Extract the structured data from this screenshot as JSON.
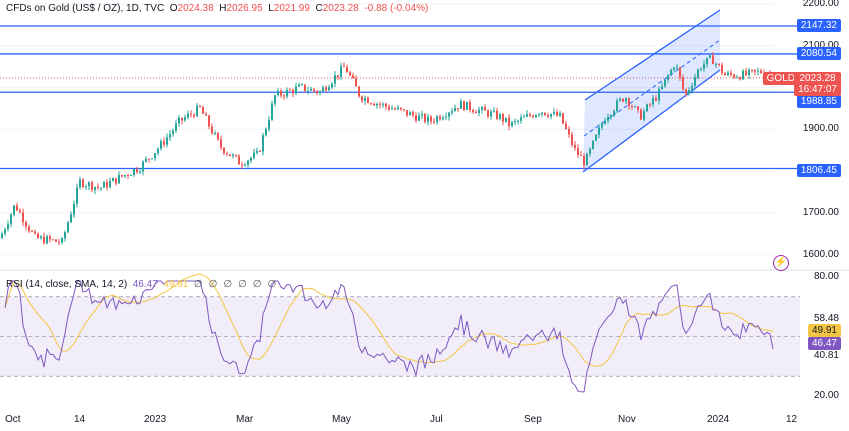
{
  "header": {
    "symbol": "CFDs on Gold (US$ / OZ), 1D, TVC",
    "o_label": "O",
    "o": "2024.38",
    "h_label": "H",
    "h": "2026.95",
    "l_label": "L",
    "l": "2021.99",
    "c_label": "C",
    "c": "2023.28",
    "change": "-0.88 (-0.04%)"
  },
  "rsi_header": {
    "label": "RSI (14, close, SMA, 14, 2)",
    "rsi": "46.47",
    "sma": "49.91",
    "empty_values": [
      "∅",
      "∅",
      "∅",
      "∅",
      "∅",
      "∅"
    ]
  },
  "price_axis": [
    "2200.00",
    "2100.00",
    "1900.00",
    "1700.00",
    "1600.00"
  ],
  "levels": [
    "2147.32",
    "2080.54",
    "1988.85",
    "1806.45"
  ],
  "symbol_tag": "GOLD",
  "last_price": "2023.28",
  "countdown": "16:47:07",
  "rsi_axis": [
    "80.00",
    "58.48",
    "40.81",
    "20.00"
  ],
  "rsi_tags": {
    "sma": "49.91",
    "rsi": "46.47"
  },
  "x_axis": [
    "Oct",
    "14",
    "2023",
    "Mar",
    "May",
    "Jul",
    "Sep",
    "Nov",
    "2024",
    "12"
  ],
  "colors": {
    "up": "#26a69a",
    "down": "#ef5350",
    "level": "#2962ff",
    "rsi": "#7e57c2",
    "sma": "#f4c542"
  }
}
